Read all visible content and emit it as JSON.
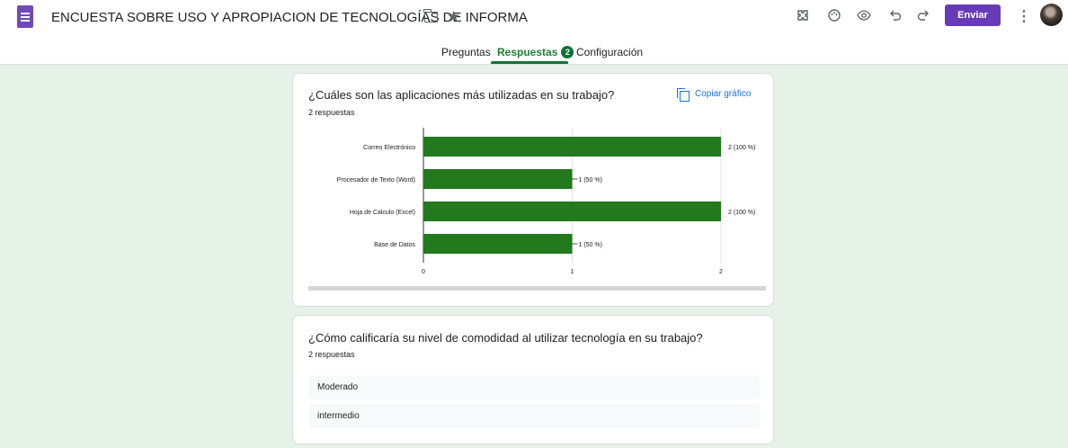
{
  "header": {
    "title": "ENCUESTA SOBRE USO Y APROPIACION DE TECNOLOGÍAS DE INFORMA",
    "send_label": "Enviar",
    "icons": [
      "customize-icon",
      "palette-icon",
      "preview-icon",
      "undo-icon",
      "redo-icon",
      "more-vert-icon"
    ]
  },
  "tabs": {
    "questions": "Preguntas",
    "responses": "Respuestas",
    "responses_count": "2",
    "settings": "Configuración"
  },
  "question1": {
    "title": "¿Cuáles son las aplicaciones más utilizadas en su trabajo?",
    "responses_text": "2 respuestas",
    "copy_label": "Copiar gráfico"
  },
  "chart_data": {
    "type": "bar",
    "orientation": "horizontal",
    "categories": [
      "Correo Electrónico",
      "Procesador de Texto (Word)",
      "Hoja de Calculo (Excel)",
      "Base de Datos"
    ],
    "values": [
      2,
      1,
      2,
      1
    ],
    "data_labels": [
      "2 (100 %)",
      "1 (50 %)",
      "2 (100 %)",
      "1 (50 %)"
    ],
    "xticks": [
      "0",
      "1",
      "2"
    ],
    "xlim": [
      0,
      2
    ],
    "color": "#23791e",
    "grid": true
  },
  "question2": {
    "title": "¿Cómo calificaría su nivel de comodidad al utilizar tecnología en su trabajo?",
    "responses_text": "2 respuestas",
    "answers": [
      "Moderado",
      "intermedio"
    ]
  },
  "colors": {
    "brand": "#673ab7",
    "accent_green": "#137333",
    "background": "#e6f2e8",
    "link": "#1a73e8"
  }
}
